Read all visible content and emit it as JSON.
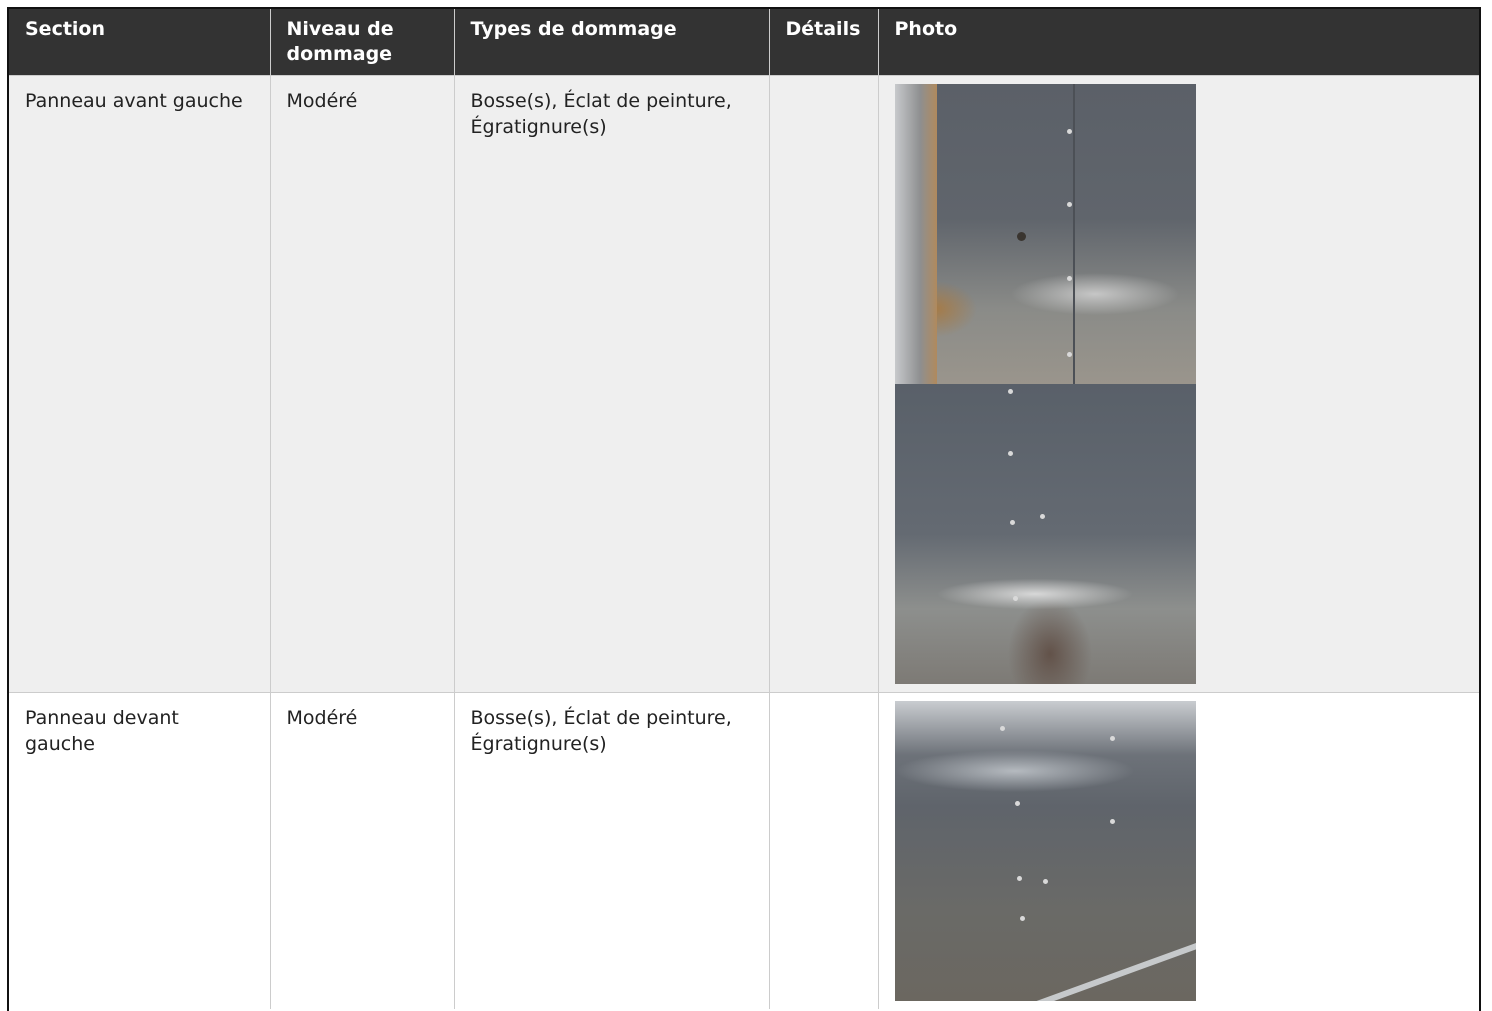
{
  "table": {
    "headers": {
      "section": "Section",
      "level": "Niveau de dommage",
      "types": "Types de dommage",
      "details": "Détails",
      "photo": "Photo"
    },
    "rows": [
      {
        "section": "Panneau avant gauche",
        "level": "Modéré",
        "types": "Bosse(s), Éclat de peinture, Égratignure(s)",
        "details": ""
      },
      {
        "section": "Panneau devant gauche",
        "level": "Modéré",
        "types": "Bosse(s), Éclat de peinture, Égratignure(s)",
        "details": ""
      }
    ]
  }
}
